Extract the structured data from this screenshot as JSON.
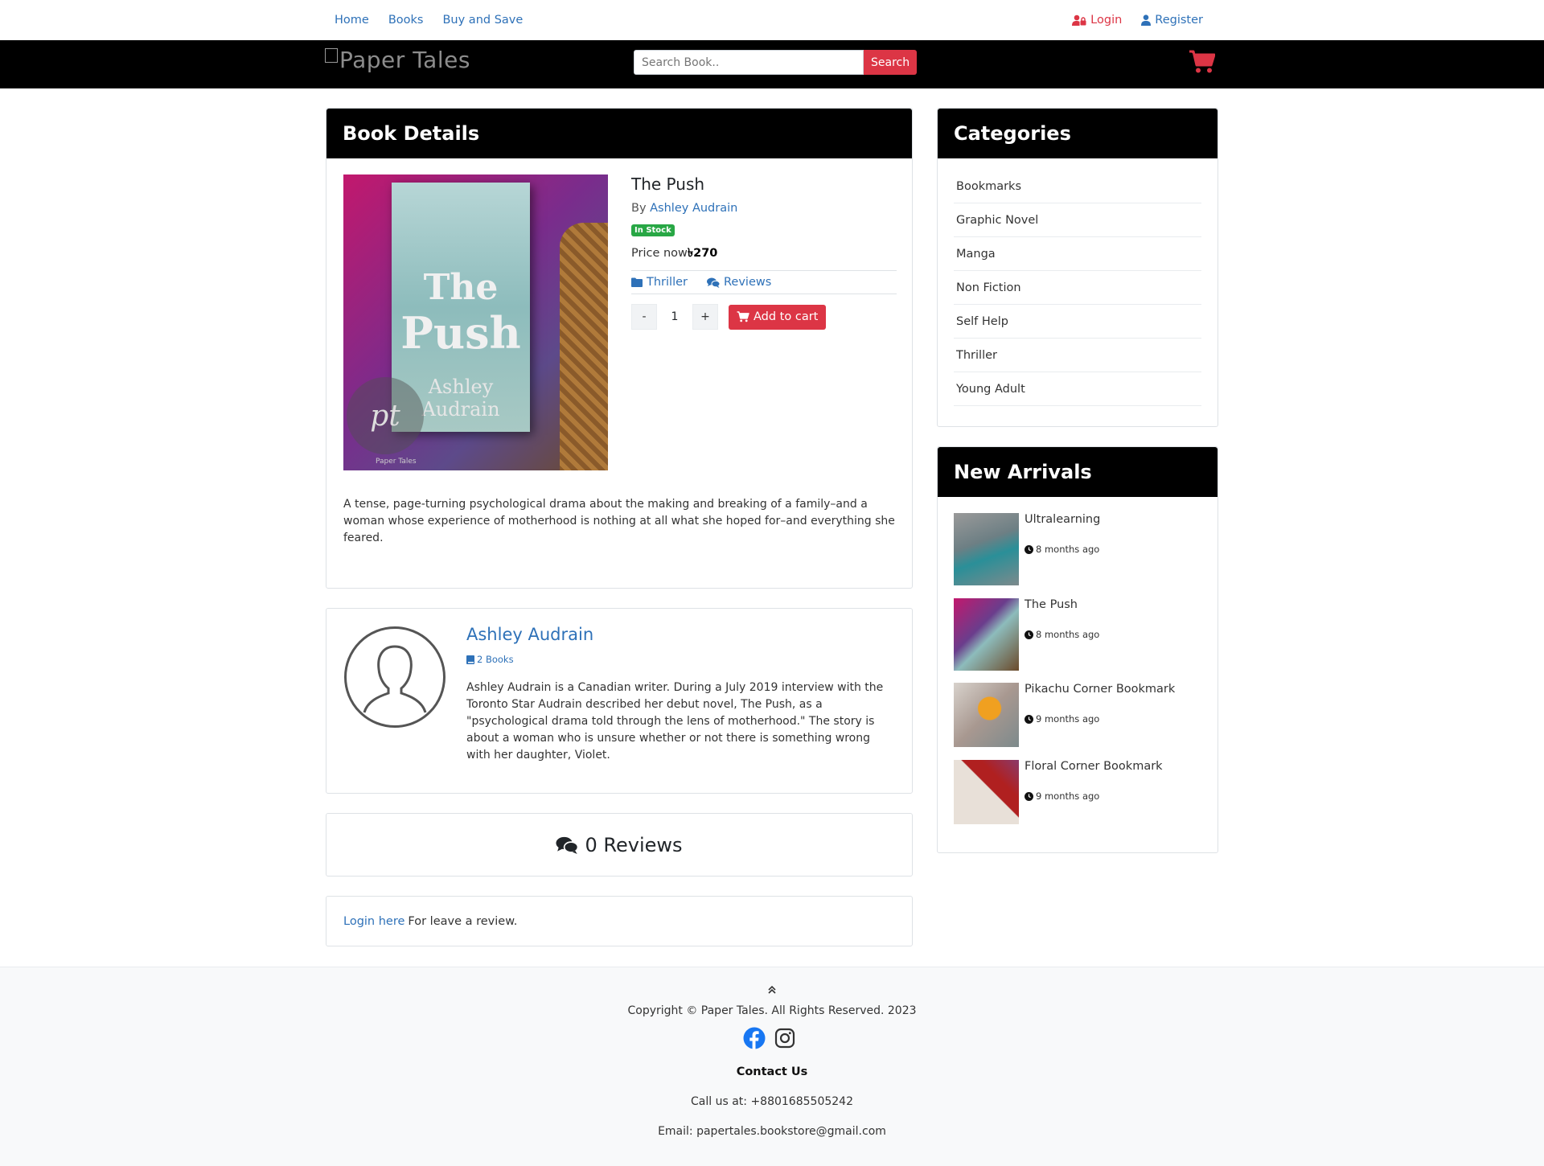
{
  "topnav": {
    "links": [
      "Home",
      "Books",
      "Buy and Save"
    ],
    "login": "Login",
    "register": "Register"
  },
  "header": {
    "logo_text": "Paper Tales",
    "search_placeholder": "Search Book..",
    "search_button": "Search"
  },
  "book_details": {
    "heading": "Book Details",
    "title": "The Push",
    "by_label": "By",
    "author": "Ashley Audrain",
    "stock_badge": "In Stock",
    "price_label": "Price  now",
    "price_value": "৳270",
    "category_link": "Thriller",
    "reviews_link": "Reviews",
    "quantity": "1",
    "minus": "-",
    "plus": "+",
    "add_to_cart": "Add to cart",
    "description": "A tense, page-turning psychological drama about the making and breaking of a family–and a woman whose experience of motherhood is nothing at all what she hoped for–and everything she feared.",
    "cover_text": {
      "line1": "The",
      "line2": "Push",
      "line3": "Ashley Audrain",
      "seal": "pt",
      "seal_caption": "Paper Tales"
    }
  },
  "author_card": {
    "name": "Ashley Audrain",
    "books_count": "2 Books",
    "bio": "Ashley Audrain is a Canadian writer. During a July 2019 interview with the Toronto Star Audrain described her debut novel, The Push, as a \"psychological drama told through the lens of motherhood.\" The story is about a woman who is unsure whether or not there is something wrong with her daughter, Violet."
  },
  "reviews": {
    "label": "0 Reviews"
  },
  "login_prompt": {
    "link": "Login here",
    "text": "For leave a review."
  },
  "categories": {
    "heading": "Categories",
    "items": [
      "Bookmarks",
      "Graphic Novel",
      "Manga",
      "Non Fiction",
      "Self Help",
      "Thriller",
      "Young Adult"
    ]
  },
  "new_arrivals": {
    "heading": "New Arrivals",
    "items": [
      {
        "title": "Ultralearning",
        "time": "8 months ago"
      },
      {
        "title": "The Push",
        "time": "8 months ago"
      },
      {
        "title": "Pikachu Corner Bookmark",
        "time": "9 months ago"
      },
      {
        "title": "Floral Corner Bookmark",
        "time": "9 months ago"
      }
    ]
  },
  "footer": {
    "copyright": "Copyright © Paper Tales. All Rights Reserved. 2023",
    "contact_heading": "Contact Us",
    "call": "Call us at: +8801685505242",
    "email": "Email: papertales.bookstore@gmail.com"
  },
  "colors": {
    "accent_red": "#dc3545",
    "link_blue": "#2e71b8",
    "header_black": "#000000",
    "stock_green": "#28a745"
  },
  "icons": [
    "user-lock-icon",
    "user-icon",
    "shopping-cart-icon",
    "folder-icon",
    "comments-icon",
    "book-icon",
    "clock-icon",
    "chevron-up-icon",
    "facebook-icon",
    "instagram-icon"
  ]
}
